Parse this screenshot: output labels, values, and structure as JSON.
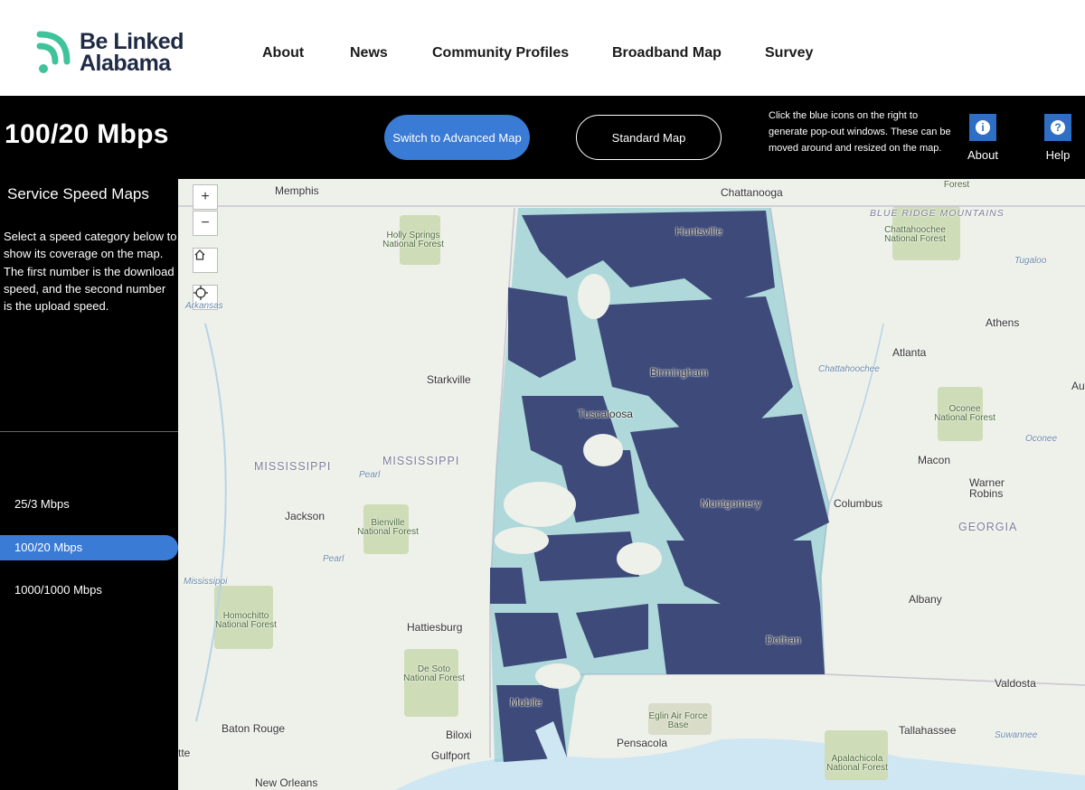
{
  "brand": {
    "line1": "Be Linked",
    "line2": "Alabama",
    "colors": {
      "green": "#3fc39a",
      "navy": "#1f2a44"
    }
  },
  "nav": [
    "About",
    "News",
    "Community Profiles",
    "Broadband Map",
    "Survey"
  ],
  "toolbar": {
    "title": "100/20 Mbps",
    "advanced_button": "Switch to Advanced Map",
    "standard_button": "Standard Map",
    "help_note": "Click the blue icons on the right to generate pop-out windows. These can be moved around and resized on the map.",
    "about_label": "About",
    "help_label": "Help",
    "accent": "#3a7bd5"
  },
  "sidebar": {
    "heading": "Service Speed Maps",
    "description": "Select a speed category below to show its coverage on the map. The first number is the download speed, and the second number is the upload speed.",
    "speeds": [
      "25/3 Mbps",
      "100/20 Mbps",
      "1000/1000 Mbps"
    ],
    "selected": "100/20 Mbps"
  },
  "map": {
    "controls": {
      "zoom_in": "+",
      "zoom_out": "−"
    },
    "cities": [
      "Memphis",
      "Chattanooga",
      "Huntsville",
      "Athens",
      "Atlanta",
      "Birmingham",
      "Starkville",
      "Tuscaloosa",
      "Macon",
      "Warner Robins",
      "Columbus",
      "Montgomery",
      "Jackson",
      "Hattiesburg",
      "Albany",
      "Dothan",
      "Valdosta",
      "Mobile",
      "Baton Rouge",
      "Biloxi",
      "Gulfport",
      "Pensacola",
      "Tallahassee",
      "New Orleans",
      "Au",
      "tte"
    ],
    "states": [
      "MISSISSIPPI",
      "MISSISSIPPI",
      "GEORGIA",
      "BLUE RIDGE MOUNTAINS"
    ],
    "parks": [
      "Holly Springs National Forest",
      "Chattahoochee National Forest",
      "Oconee National Forest",
      "Bienville National Forest",
      "Homochitto National Forest",
      "De Soto National Forest",
      "Eglin Air Force Base",
      "Apalachicola National Forest",
      "Forest"
    ],
    "rivers": [
      "Arkansas",
      "Pearl",
      "Pearl",
      "Mississippi",
      "Chattahoochee",
      "Tugaloo",
      "Oconee",
      "Suwannee"
    ],
    "colors": {
      "coverage_dark": "#3d4a7a",
      "coverage_light": "#7cc5cc",
      "land": "#eef0ea",
      "water": "#cfe6f3",
      "forest": "#cfdcb8"
    }
  }
}
